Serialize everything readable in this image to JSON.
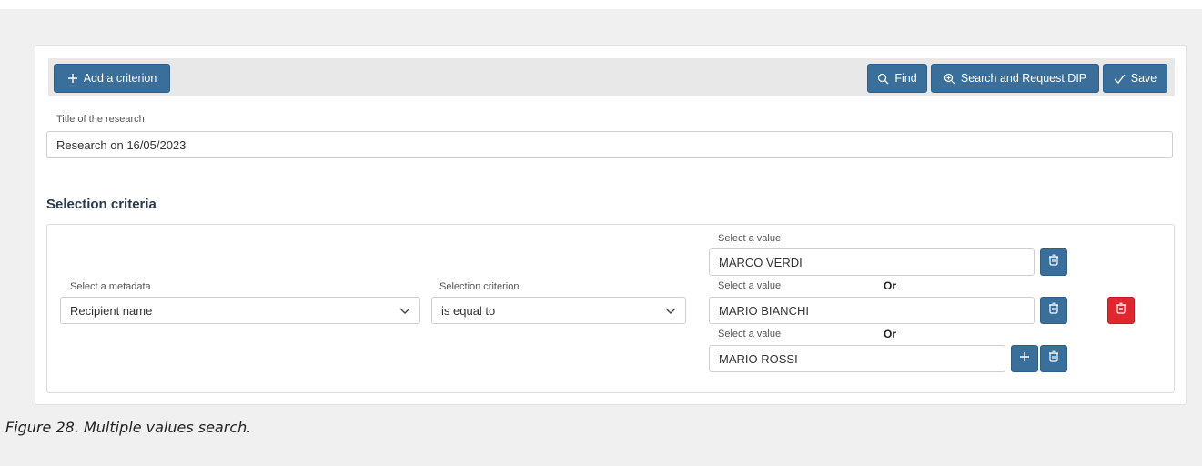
{
  "toolbar": {
    "add_criterion_label": "Add a criterion",
    "find_label": "Find",
    "search_request_label": "Search and Request DIP",
    "save_label": "Save"
  },
  "research": {
    "title_label": "Title of the research",
    "title_value": "Research on 16/05/2023"
  },
  "criteria": {
    "section_title": "Selection criteria",
    "metadata_label": "Select a metadata",
    "metadata_value": "Recipient name",
    "criterion_label": "Selection criterion",
    "criterion_value": "is equal to",
    "values": [
      {
        "label": "Select a value",
        "value": "MARCO VERDI",
        "connector": ""
      },
      {
        "label": "Select a value",
        "value": "MARIO BIANCHI",
        "connector": "Or"
      },
      {
        "label": "Select a value",
        "value": "MARIO ROSSI",
        "connector": "Or"
      }
    ]
  },
  "caption": "Figure 28. Multiple values search.",
  "colors": {
    "primary_button": "#3a6f9c",
    "delete_button": "#e0262f"
  },
  "icons": [
    "plus-icon",
    "search-icon",
    "zoom-search-icon",
    "check-icon",
    "chevron-down-icon",
    "trash-icon"
  ]
}
